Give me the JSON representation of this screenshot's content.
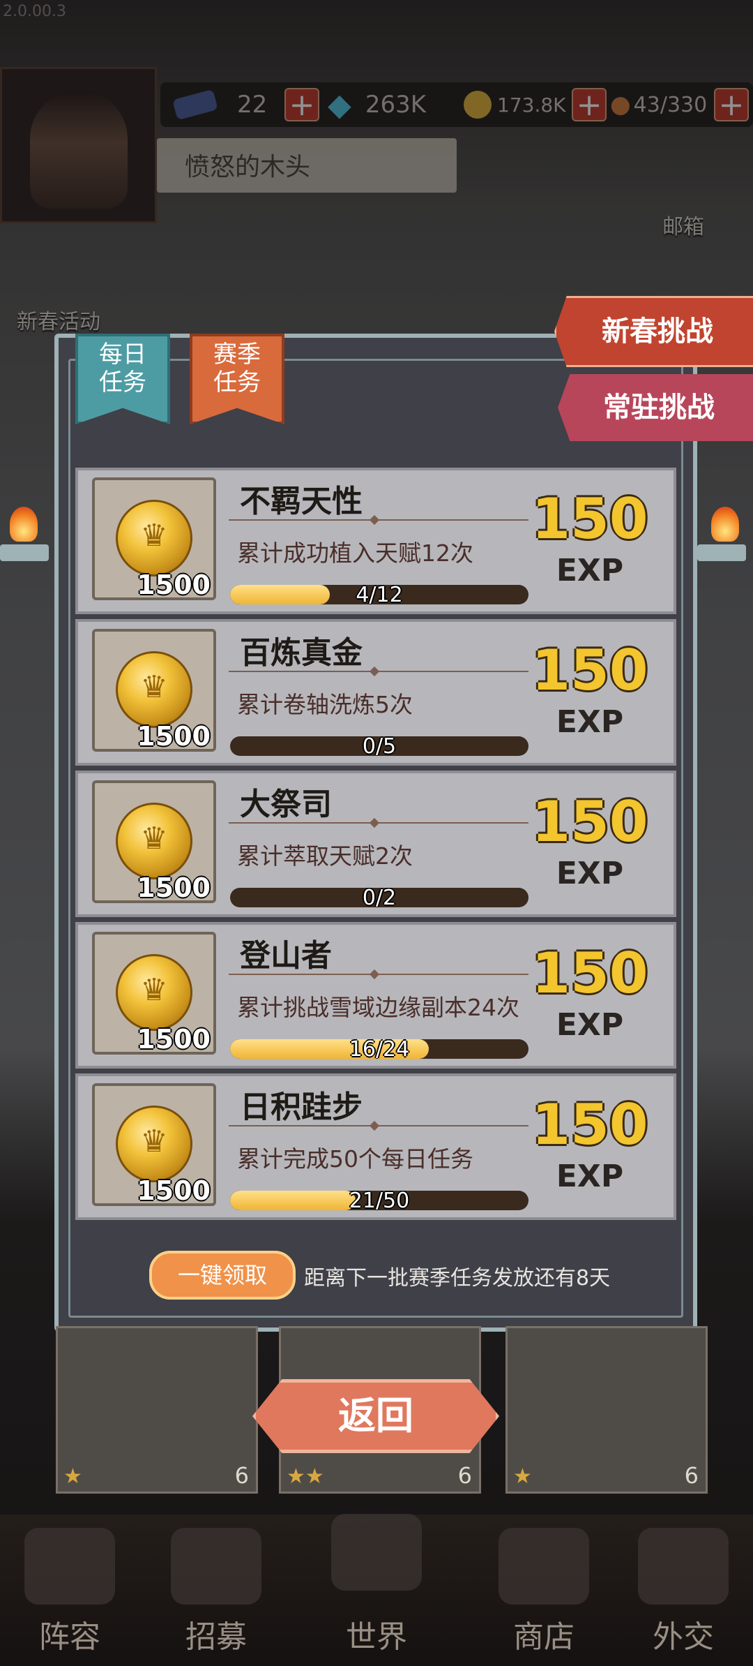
{
  "version": "2.0.00.3",
  "resources": {
    "tickets": "22",
    "diamonds": "263K",
    "gold": "173.8K",
    "stamina": "43/330"
  },
  "player": {
    "name": "愤怒的木头"
  },
  "side": {
    "mail": "邮箱",
    "new_year_activity": "新春活动"
  },
  "tabs": {
    "daily": "每日\n任务",
    "season": "赛季\n任务"
  },
  "ribbons": {
    "new_year_challenge": "新春挑战",
    "permanent_challenge": "常驻挑战"
  },
  "tasks": [
    {
      "title": "不羁天性",
      "desc": "累计成功植入天赋12次",
      "progress": "4/12",
      "fraction": 0.333,
      "reward": "1500",
      "exp": "150",
      "exp_label": "EXP"
    },
    {
      "title": "百炼真金",
      "desc": "累计卷轴洗炼5次",
      "progress": "0/5",
      "fraction": 0.0,
      "reward": "1500",
      "exp": "150",
      "exp_label": "EXP"
    },
    {
      "title": "大祭司",
      "desc": "累计萃取天赋2次",
      "progress": "0/2",
      "fraction": 0.0,
      "reward": "1500",
      "exp": "150",
      "exp_label": "EXP"
    },
    {
      "title": "登山者",
      "desc": "累计挑战雪域边缘副本24次",
      "progress": "16/24",
      "fraction": 0.667,
      "reward": "1500",
      "exp": "150",
      "exp_label": "EXP"
    },
    {
      "title": "日积跬步",
      "desc": "累计完成50个每日任务",
      "progress": "21/50",
      "fraction": 0.42,
      "reward": "1500",
      "exp": "150",
      "exp_label": "EXP"
    }
  ],
  "footer": {
    "claim_all": "一键领取",
    "note": "距离下一批赛季任务发放还有8天",
    "back": "返回"
  },
  "cards": [
    "6",
    "6",
    "6"
  ],
  "nav": [
    "阵容",
    "招募",
    "世界",
    "商店",
    "外交"
  ],
  "colors": {
    "accent_gold": "#f3c52e",
    "progress_fill": "#f0b534",
    "panel_border": "#9fb2b6"
  }
}
